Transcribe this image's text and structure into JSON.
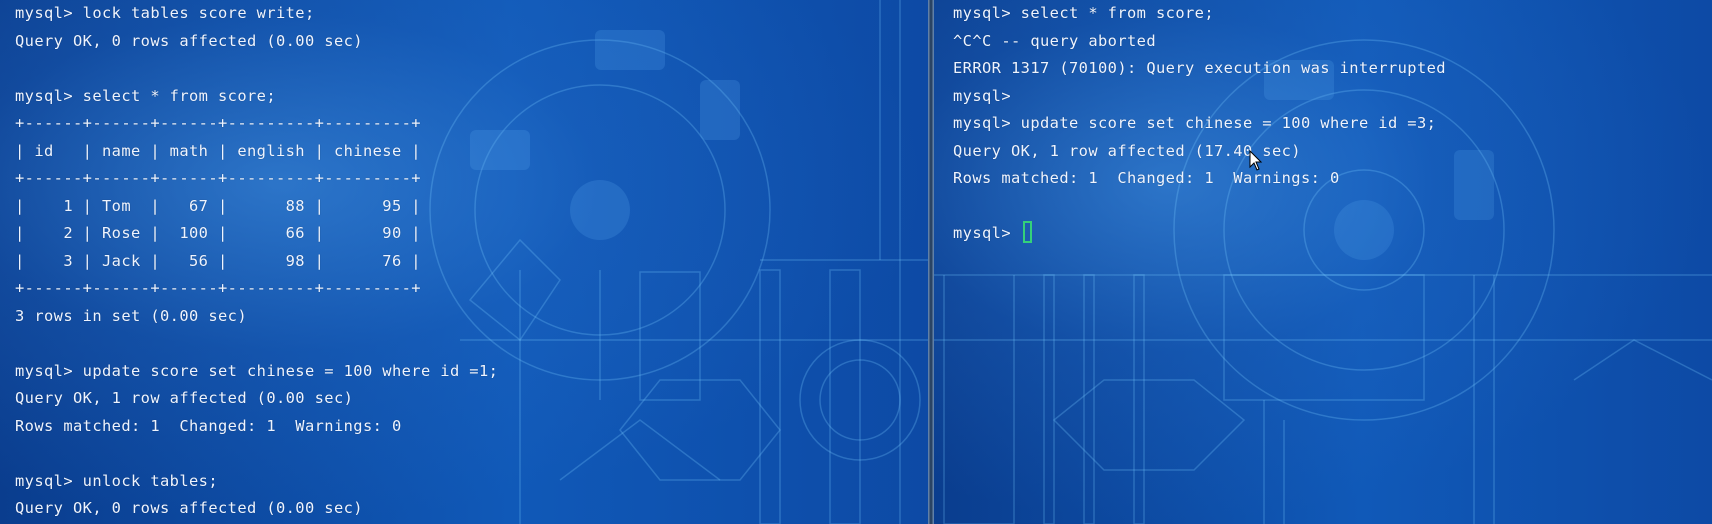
{
  "left_terminal": {
    "lines": [
      "mysql> lock tables score write;",
      "Query OK, 0 rows affected (0.00 sec)",
      "",
      "mysql> select * from score;",
      "+------+------+------+---------+---------+",
      "| id   | name | math | english | chinese |",
      "+------+------+------+---------+---------+",
      "|    1 | Tom  |   67 |      88 |      95 |",
      "|    2 | Rose |  100 |      66 |      90 |",
      "|    3 | Jack |   56 |      98 |      76 |",
      "+------+------+------+---------+---------+",
      "3 rows in set (0.00 sec)",
      "",
      "mysql> update score set chinese = 100 where id =1;",
      "Query OK, 1 row affected (0.00 sec)",
      "Rows matched: 1  Changed: 1  Warnings: 0",
      "",
      "mysql> unlock tables;",
      "Query OK, 0 rows affected (0.00 sec)"
    ]
  },
  "right_terminal": {
    "lines": [
      "mysql> select * from score;",
      "^C^C -- query aborted",
      "ERROR 1317 (70100): Query execution was interrupted",
      "mysql>",
      "mysql> update score set chinese = 100 where id =3;",
      "Query OK, 1 row affected (17.40 sec)",
      "Rows matched: 1  Changed: 1  Warnings: 0",
      ""
    ],
    "prompt": "mysql> "
  },
  "colors": {
    "text": "#eef4ff",
    "cursor": "#34d17a",
    "background": "#0d4aa5"
  }
}
